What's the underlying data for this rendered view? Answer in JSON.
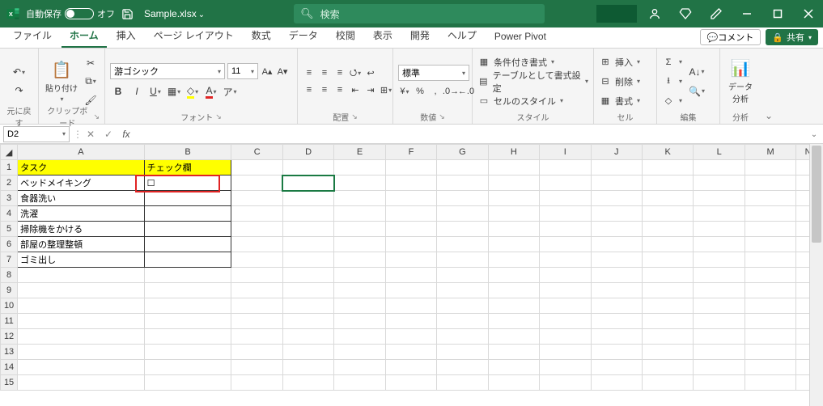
{
  "titlebar": {
    "autosave_label": "自動保存",
    "autosave_state": "オフ",
    "filename": "Sample.xlsx",
    "search_placeholder": "検索"
  },
  "tabs": {
    "file": "ファイル",
    "home": "ホーム",
    "insert": "挿入",
    "pagelayout": "ページ レイアウト",
    "formulas": "数式",
    "data": "データ",
    "review": "校閲",
    "view": "表示",
    "developer": "開発",
    "help": "ヘルプ",
    "powerpivot": "Power Pivot",
    "comments": "コメント",
    "share": "共有"
  },
  "ribbon": {
    "undo_group": "元に戻す",
    "clipboard_group": "クリップボード",
    "paste": "貼り付け",
    "font_group": "フォント",
    "font_name": "游ゴシック",
    "font_size": "11",
    "align_group": "配置",
    "number_group": "数値",
    "number_format": "標準",
    "styles_group": "スタイル",
    "cond_fmt": "条件付き書式",
    "as_table": "テーブルとして書式設定",
    "cell_styles": "セルのスタイル",
    "cells_group": "セル",
    "insert_cells": "挿入",
    "delete_cells": "削除",
    "format_cells": "書式",
    "editing_group": "編集",
    "analysis_group": "分析",
    "analysis_btn": "データ\n分析"
  },
  "formula_bar": {
    "name_box": "D2",
    "formula": ""
  },
  "columns": [
    "A",
    "B",
    "C",
    "D",
    "E",
    "F",
    "G",
    "H",
    "I",
    "J",
    "K",
    "L",
    "M",
    "N"
  ],
  "sheet": {
    "header_task": "タスク",
    "header_check": "チェック欄",
    "rows": [
      {
        "task": "ベッドメイキング",
        "check": "☐"
      },
      {
        "task": "食器洗い",
        "check": ""
      },
      {
        "task": "洗濯",
        "check": ""
      },
      {
        "task": "掃除機をかける",
        "check": ""
      },
      {
        "task": "部屋の整理整頓",
        "check": ""
      },
      {
        "task": "ゴミ出し",
        "check": ""
      }
    ]
  }
}
